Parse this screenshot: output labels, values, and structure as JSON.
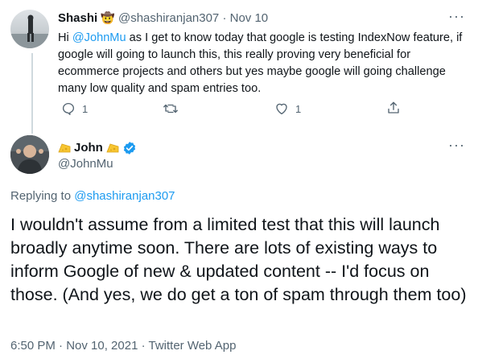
{
  "reply_tweet": {
    "author_name": "Shashi",
    "author_emoji": "🤠",
    "handle": "@shashiranjan307",
    "dot": "·",
    "date": "Nov 10",
    "text_parts": {
      "hi": "Hi ",
      "mention": "@JohnMu",
      "rest": " as I get to know today that google is testing IndexNow feature, if google will going to launch this, this really proving very beneficial for ecommerce projects and others but yes maybe google will going challenge many low quality and spam entries too."
    },
    "reply_count": "1",
    "like_count": "1",
    "more": "···"
  },
  "main_tweet": {
    "author_name": "John",
    "handle": "@JohnMu",
    "more": "···",
    "replying_to_label": "Replying to ",
    "replying_to_handle": "@shashiranjan307",
    "text": "I wouldn't assume from a limited test that this will launch broadly anytime soon. There are lots of existing ways to inform Google of new & updated content -- I'd focus on those. (And yes, we do get a ton of spam through them too)",
    "timestamp": "6:50 PM · Nov 10, 2021 · Twitter Web App"
  },
  "colors": {
    "link": "#1d9bf0",
    "muted": "#536471",
    "text": "#0f1419",
    "verified": "#1d9bf0",
    "cheese": "#f7c531"
  }
}
